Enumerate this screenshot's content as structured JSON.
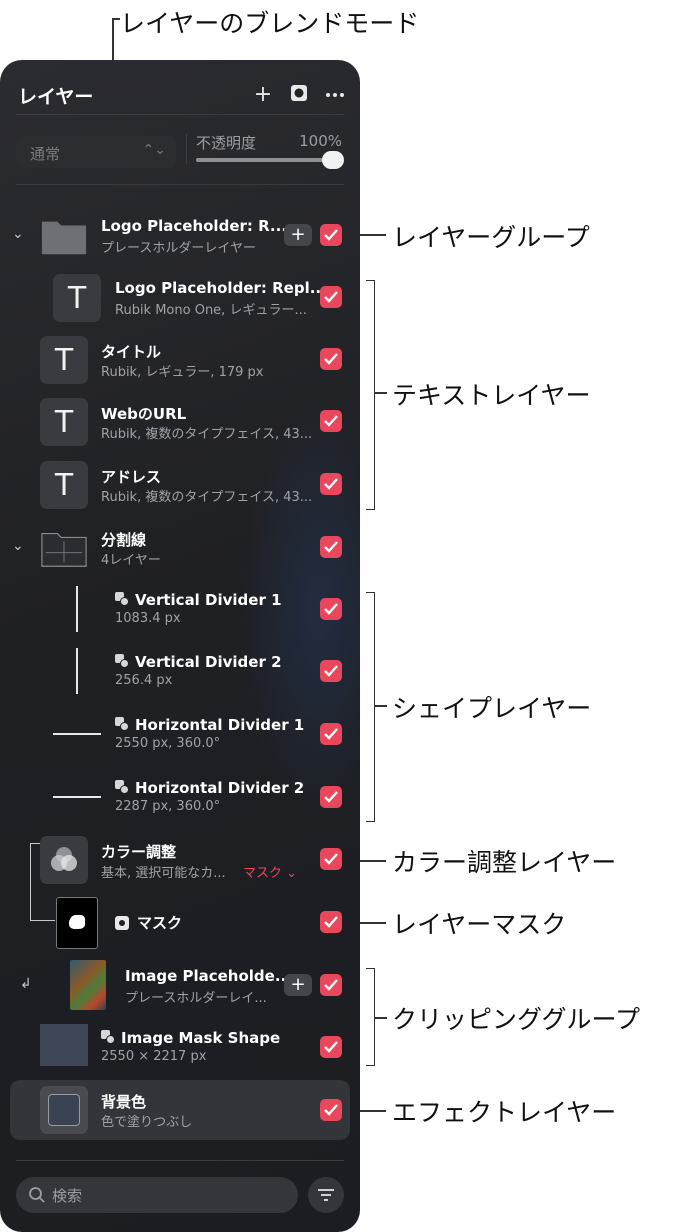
{
  "callouts": {
    "blend_mode": "レイヤーのブレンドモード",
    "layer_group": "レイヤーグループ",
    "text_layers": "テキストレイヤー",
    "shape_layers": "シェイプレイヤー",
    "color_adjust": "カラー調整レイヤー",
    "layer_mask": "レイヤーマスク",
    "clipping_group": "クリッピンググループ",
    "effect_layer": "エフェクトレイヤー"
  },
  "header": {
    "title": "レイヤー",
    "icons": [
      "plus-icon",
      "mask-icon",
      "more-icon"
    ]
  },
  "blend": {
    "mode": "通常",
    "opacity_label": "不透明度",
    "opacity_value": "100%",
    "opacity": 1.0
  },
  "layers": [
    {
      "name": "Logo Placeholder: R...",
      "sub": "プレースホルダーレイヤー",
      "kind": "group",
      "visible": true
    },
    {
      "name": "Logo Placeholder: Repl...",
      "sub": "Rubik Mono One, レギュラー...",
      "kind": "text",
      "visible": true
    },
    {
      "name": "タイトル",
      "sub": "Rubik, レギュラー, 179 px",
      "kind": "text",
      "visible": true
    },
    {
      "name": "WebのURL",
      "sub": "Rubik, 複数のタイプフェイス, 43...",
      "kind": "text",
      "visible": true
    },
    {
      "name": "アドレス",
      "sub": "Rubik, 複数のタイプフェイス, 43...",
      "kind": "text",
      "visible": true
    },
    {
      "name": "分割線",
      "sub": "4レイヤー",
      "kind": "group",
      "visible": true
    },
    {
      "name": "Vertical Divider 1",
      "sub": "1083.4 px",
      "kind": "shape",
      "visible": true
    },
    {
      "name": "Vertical Divider 2",
      "sub": "256.4 px",
      "kind": "shape",
      "visible": true
    },
    {
      "name": "Horizontal Divider 1",
      "sub": "2550 px, 360.0°",
      "kind": "shape",
      "visible": true
    },
    {
      "name": "Horizontal Divider 2",
      "sub": "2287 px, 360.0°",
      "kind": "shape",
      "visible": true
    },
    {
      "name": "カラー調整",
      "sub": "基本, 選択可能なカ...",
      "kind": "adjustment",
      "mask_label": "マスク",
      "visible": true
    },
    {
      "name": "マスク",
      "sub": "",
      "kind": "mask",
      "visible": true
    },
    {
      "name": "Image Placeholde...",
      "sub": "プレースホルダーレイ...",
      "kind": "image",
      "visible": true
    },
    {
      "name": "Image Mask Shape",
      "sub": "2550 × 2217 px",
      "kind": "shape",
      "visible": true
    },
    {
      "name": "背景色",
      "sub": "色で塗りつぶし",
      "kind": "fill",
      "visible": true
    }
  ],
  "search": {
    "placeholder": "検索"
  },
  "colors": {
    "check": "#e8475c",
    "panel": "#1f2024",
    "accent_mask": "#e8475c"
  }
}
